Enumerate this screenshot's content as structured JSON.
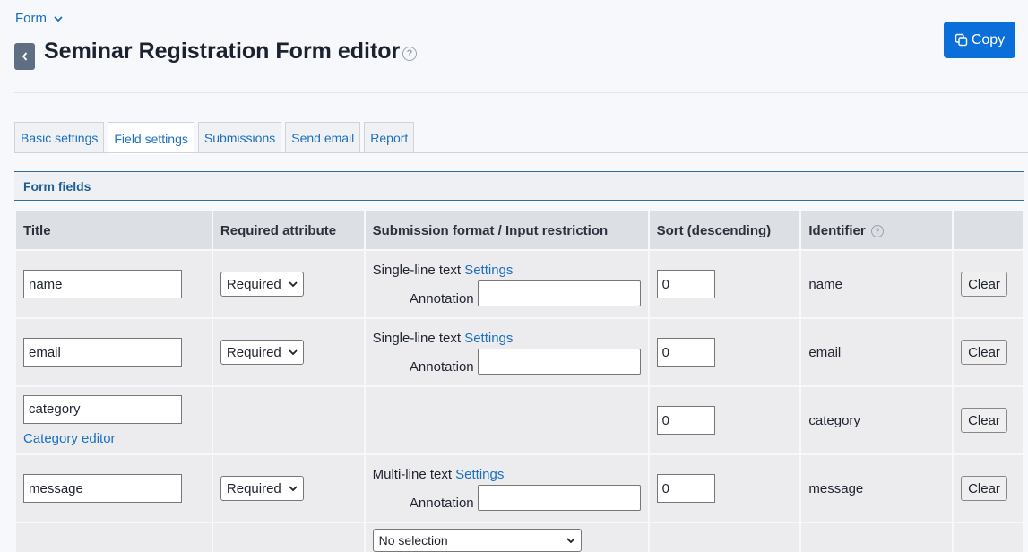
{
  "breadcrumb": {
    "label": "Form"
  },
  "header": {
    "title": "Seminar Registration Form editor",
    "copy_label": "Copy"
  },
  "tabs": [
    {
      "label": "Basic settings"
    },
    {
      "label": "Field settings"
    },
    {
      "label": "Submissions"
    },
    {
      "label": "Send email"
    },
    {
      "label": "Report"
    }
  ],
  "section": {
    "title": "Form fields"
  },
  "table": {
    "headers": [
      "Title",
      "Required attribute",
      "Submission format / Input restriction",
      "Sort (descending)",
      "Identifier",
      ""
    ],
    "rows": [
      {
        "title": "name",
        "required": "Required",
        "format": "Single-line text",
        "settings": "Settings",
        "annotation_label": "Annotation",
        "sort": "0",
        "identifier": "name",
        "clear": "Clear"
      },
      {
        "title": "email",
        "required": "Required",
        "format": "Single-line text",
        "settings": "Settings",
        "annotation_label": "Annotation",
        "sort": "0",
        "identifier": "email",
        "clear": "Clear"
      },
      {
        "title": "category",
        "category_link": "Category editor",
        "sort": "0",
        "identifier": "category",
        "clear": "Clear"
      },
      {
        "title": "message",
        "required": "Required",
        "format": "Multi-line text",
        "settings": "Settings",
        "annotation_label": "Annotation",
        "sort": "0",
        "identifier": "message",
        "clear": "Clear"
      },
      {
        "format_select": "No selection"
      }
    ]
  }
}
